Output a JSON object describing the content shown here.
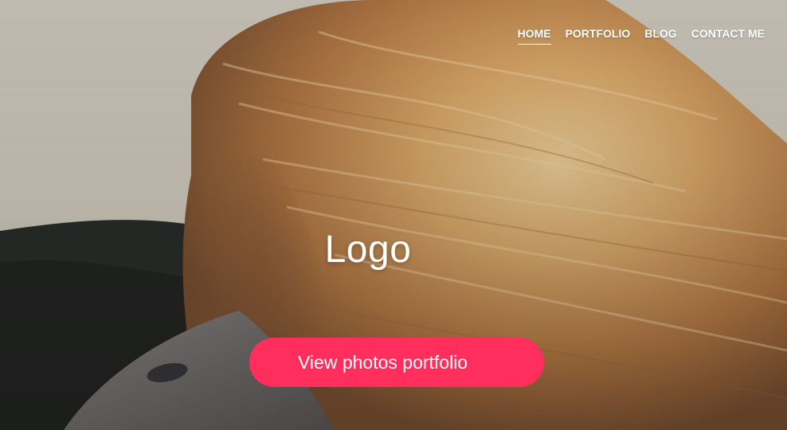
{
  "nav": {
    "items": [
      {
        "label": "HOME",
        "active": true
      },
      {
        "label": "PORTFOLIO",
        "active": false
      },
      {
        "label": "BLOG",
        "active": false
      },
      {
        "label": "CONTACT ME",
        "active": false
      }
    ]
  },
  "hero": {
    "logo_text": "Logo",
    "cta_label": "View photos portfolio",
    "background_image": "woman-blond-hair-blowing-in-wind"
  },
  "colors": {
    "accent": "#ff2e5c",
    "text": "#ffffff",
    "sky": "#d6d2c6",
    "hair": "#d9a86a",
    "hills": "#2a2d2a"
  }
}
